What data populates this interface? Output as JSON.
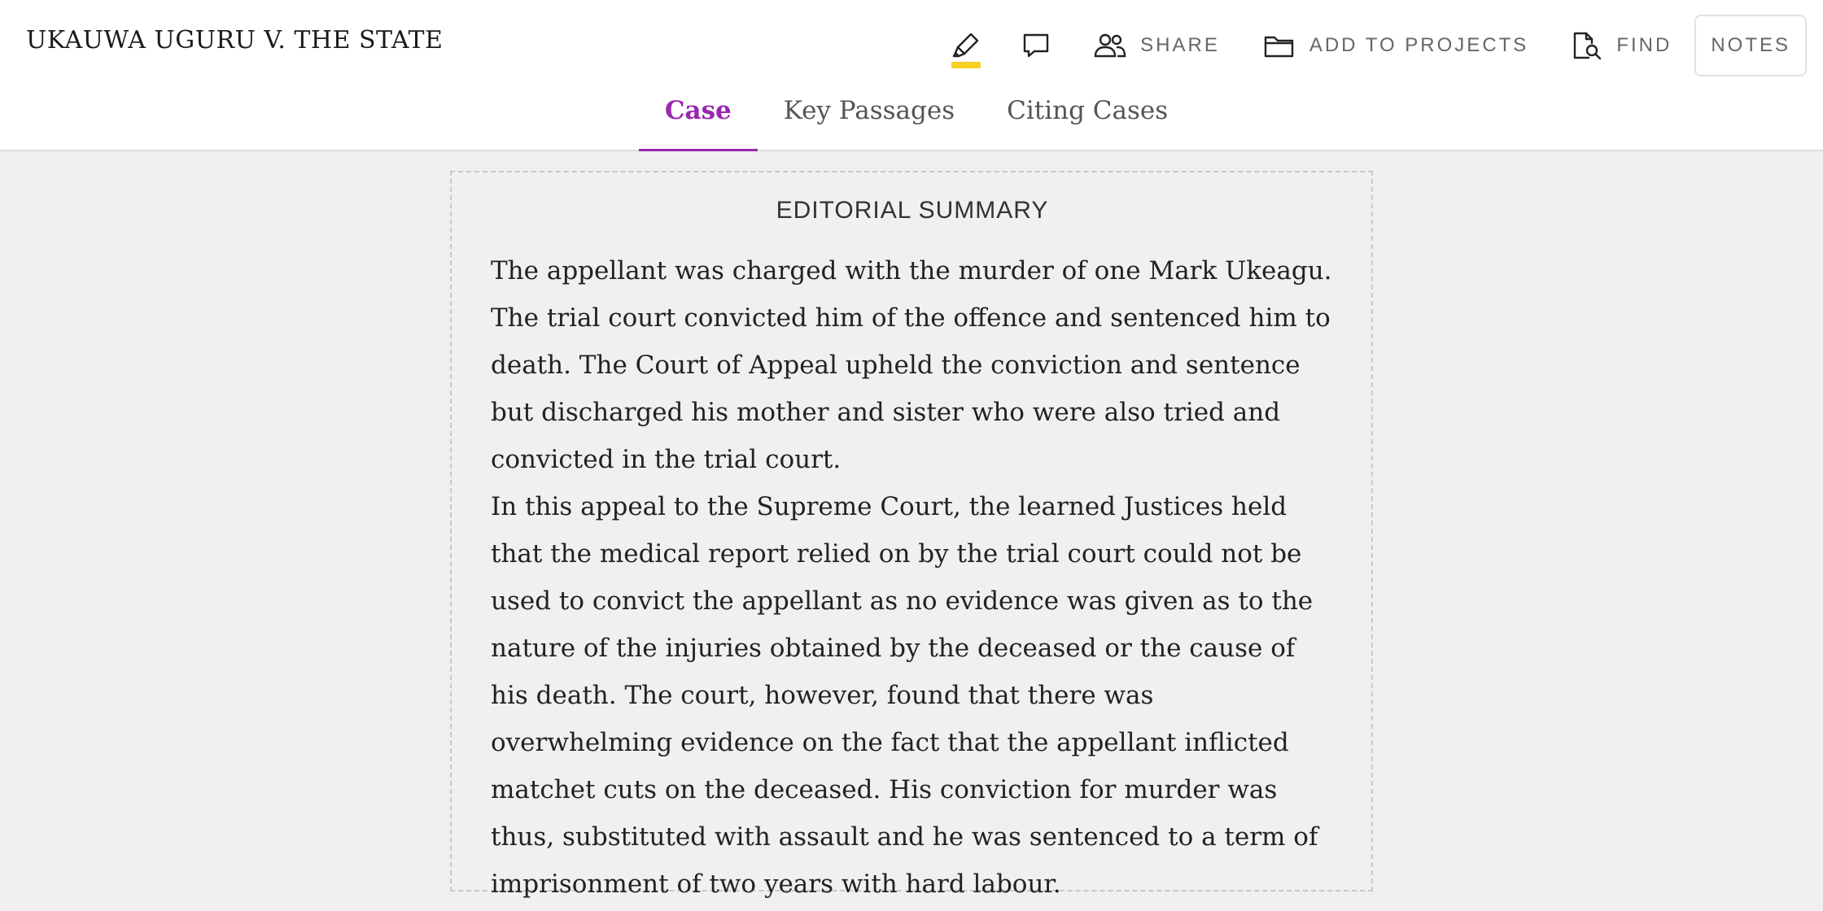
{
  "header": {
    "case_title": "UKAUWA UGURU V. THE STATE"
  },
  "toolbar": {
    "highlight_icon": "highlighter-icon",
    "highlight_color": "#f5d020",
    "comment_icon": "comment-icon",
    "share_label": "SHARE",
    "add_to_projects_label": "ADD TO PROJECTS",
    "find_label": "FIND",
    "notes_label": "NOTES"
  },
  "tabs": [
    {
      "label": "Case",
      "active": true
    },
    {
      "label": "Key Passages",
      "active": false
    },
    {
      "label": "Citing Cases",
      "active": false
    }
  ],
  "summary": {
    "heading": "EDITORIAL SUMMARY",
    "paragraphs": [
      "The appellant was charged with the murder of one Mark Ukeagu. The trial court convicted him of the offence and sentenced him to death. The Court of Appeal upheld the conviction and sentence but discharged his mother and sister who were also tried and convicted in the trial court.",
      "In this appeal to the Supreme Court, the learned Justices held that the medical report relied on by the trial court could not be used to convict the appellant as no evidence was given as to the nature of the injuries obtained by the deceased or the cause of his death. The court, however, found that there was overwhelming evidence on the fact that the appellant inflicted matchet cuts on the deceased. His conviction for murder was thus, substituted with assault and he was sentenced to a term of imprisonment of two years with hard labour."
    ]
  },
  "colors": {
    "accent": "#9b27af",
    "highlight": "#f5d020"
  }
}
